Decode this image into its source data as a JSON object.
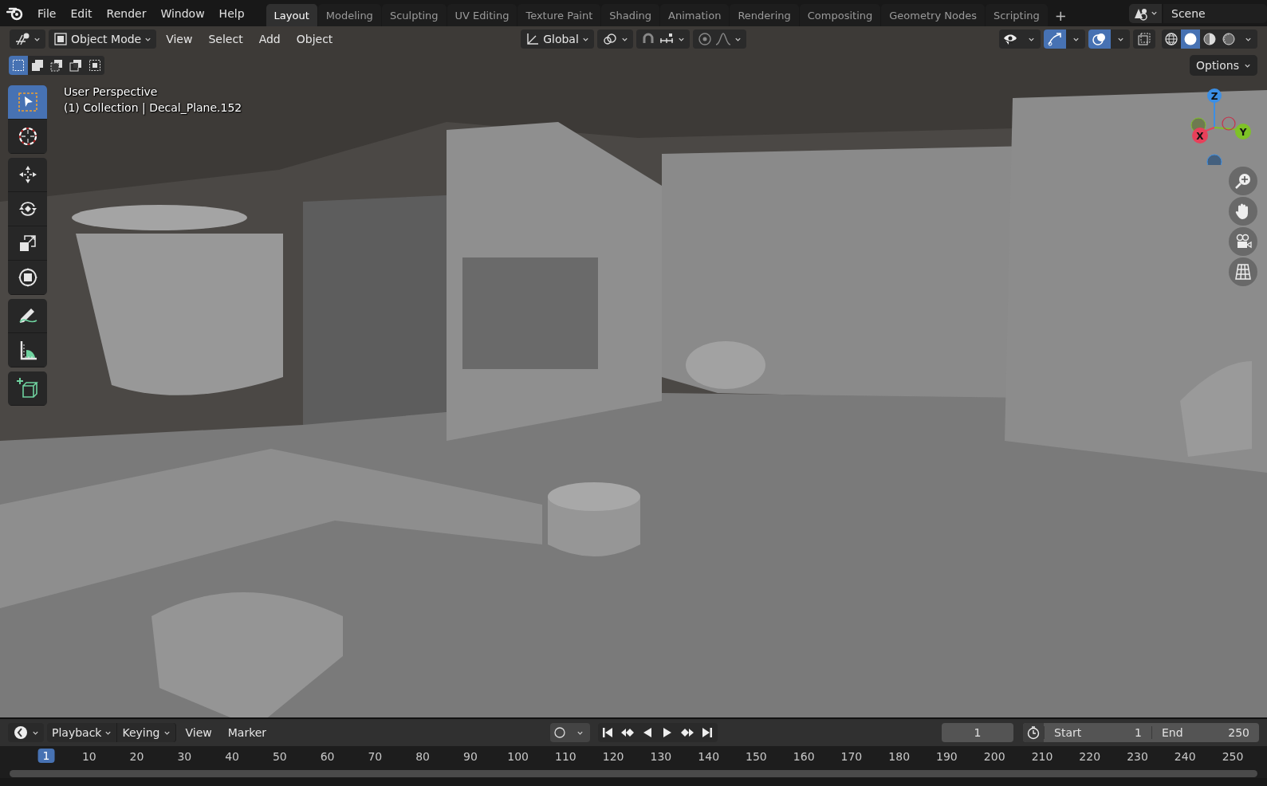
{
  "top_bar": {
    "menus": [
      "File",
      "Edit",
      "Render",
      "Window",
      "Help"
    ],
    "workspace_tabs": [
      {
        "label": "Layout",
        "selected": true
      },
      {
        "label": "Modeling",
        "selected": false
      },
      {
        "label": "Sculpting",
        "selected": false
      },
      {
        "label": "UV Editing",
        "selected": false
      },
      {
        "label": "Texture Paint",
        "selected": false
      },
      {
        "label": "Shading",
        "selected": false
      },
      {
        "label": "Animation",
        "selected": false
      },
      {
        "label": "Rendering",
        "selected": false
      },
      {
        "label": "Compositing",
        "selected": false
      },
      {
        "label": "Geometry Nodes",
        "selected": false
      },
      {
        "label": "Scripting",
        "selected": false
      }
    ],
    "add_tab": "+",
    "scene": "Scene"
  },
  "viewport_header": {
    "mode": "Object Mode",
    "menus": [
      "View",
      "Select",
      "Add",
      "Object"
    ],
    "orientation": "Global",
    "snapping": {
      "on": false
    },
    "proportional_editing": {
      "on": false
    },
    "toggles": [
      {
        "kind": "selectability",
        "on": false
      },
      {
        "kind": "gizmo",
        "on": true
      },
      {
        "kind": "overlay",
        "on": true
      },
      {
        "kind": "xray",
        "on": false
      }
    ],
    "shading": [
      {
        "kind": "wireframe",
        "selected": false
      },
      {
        "kind": "solid",
        "selected": true
      },
      {
        "kind": "material",
        "selected": false
      },
      {
        "kind": "rendered",
        "selected": false
      }
    ]
  },
  "select_modes": [
    {
      "kind": "new",
      "selected": true
    },
    {
      "kind": "extend",
      "selected": false
    },
    {
      "kind": "subtract",
      "selected": false
    },
    {
      "kind": "invert",
      "selected": false
    },
    {
      "kind": "intersect",
      "selected": false
    }
  ],
  "options": "Options",
  "overlay_text": {
    "view": "User Perspective",
    "object": "(1) Collection | Decal_Plane.152"
  },
  "toolbar": [
    [
      {
        "kind": "select_box",
        "selected": true
      },
      {
        "kind": "cursor",
        "selected": false
      }
    ],
    [
      {
        "kind": "move",
        "selected": false
      },
      {
        "kind": "rotate",
        "selected": false
      },
      {
        "kind": "scale",
        "selected": false
      },
      {
        "kind": "transform",
        "selected": false
      }
    ],
    [
      {
        "kind": "annotate",
        "selected": false
      },
      {
        "kind": "measure",
        "selected": false
      }
    ],
    [
      {
        "kind": "add_cube",
        "selected": false
      }
    ]
  ],
  "gizmo": {
    "z": "Z",
    "x": "X",
    "y": "Y"
  },
  "timeline": {
    "menus_dropdown": [
      "Playback",
      "Keying"
    ],
    "menus": [
      "View",
      "Marker"
    ],
    "auto_keying": {
      "on": false
    },
    "current_frame": "1",
    "start_label": "Start",
    "start": "1",
    "end_label": "End",
    "end": "250",
    "playhead": "1",
    "ticks": [
      "10",
      "20",
      "30",
      "40",
      "50",
      "60",
      "70",
      "80",
      "90",
      "100",
      "110",
      "120",
      "130",
      "140",
      "150",
      "160",
      "170",
      "180",
      "190",
      "200",
      "210",
      "220",
      "230",
      "240",
      "250"
    ]
  }
}
